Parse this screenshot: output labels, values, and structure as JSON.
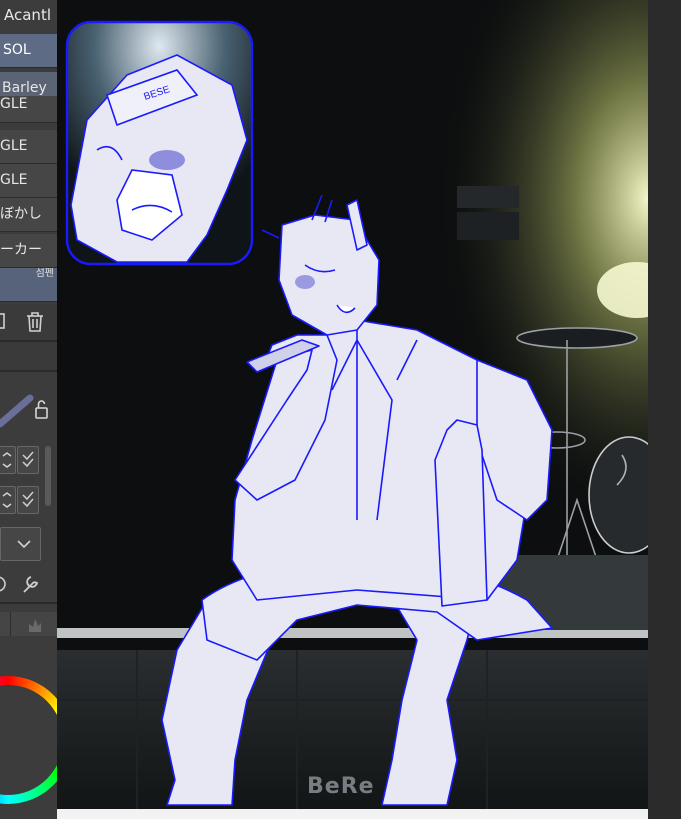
{
  "palette": {
    "title": "Acantl",
    "brushes": [
      {
        "label": "SOL",
        "state": "selected"
      },
      {
        "label": "Barley",
        "state": "selected-dim"
      },
      {
        "label": "GLE",
        "state": "normal"
      },
      {
        "label": "GLE",
        "state": "normal"
      },
      {
        "label": "GLE",
        "state": "normal"
      },
      {
        "label": "ぼかし",
        "state": "normal"
      },
      {
        "label": "ーカー",
        "state": "normal"
      },
      {
        "label": "",
        "tag": "섬펜",
        "state": "tag"
      }
    ],
    "icons": [
      "copy-icon",
      "trash-icon",
      "lock-icon",
      "chevron-down-icon",
      "settings-icon",
      "wrench-icon",
      "flame-icon"
    ]
  },
  "canvas": {
    "watermark": "BeRe",
    "background": "#0d0f10",
    "sketch_color": "#1a1aff",
    "sketch_fill": "#e8e8f4",
    "stage_light": "#f4f6c8"
  }
}
